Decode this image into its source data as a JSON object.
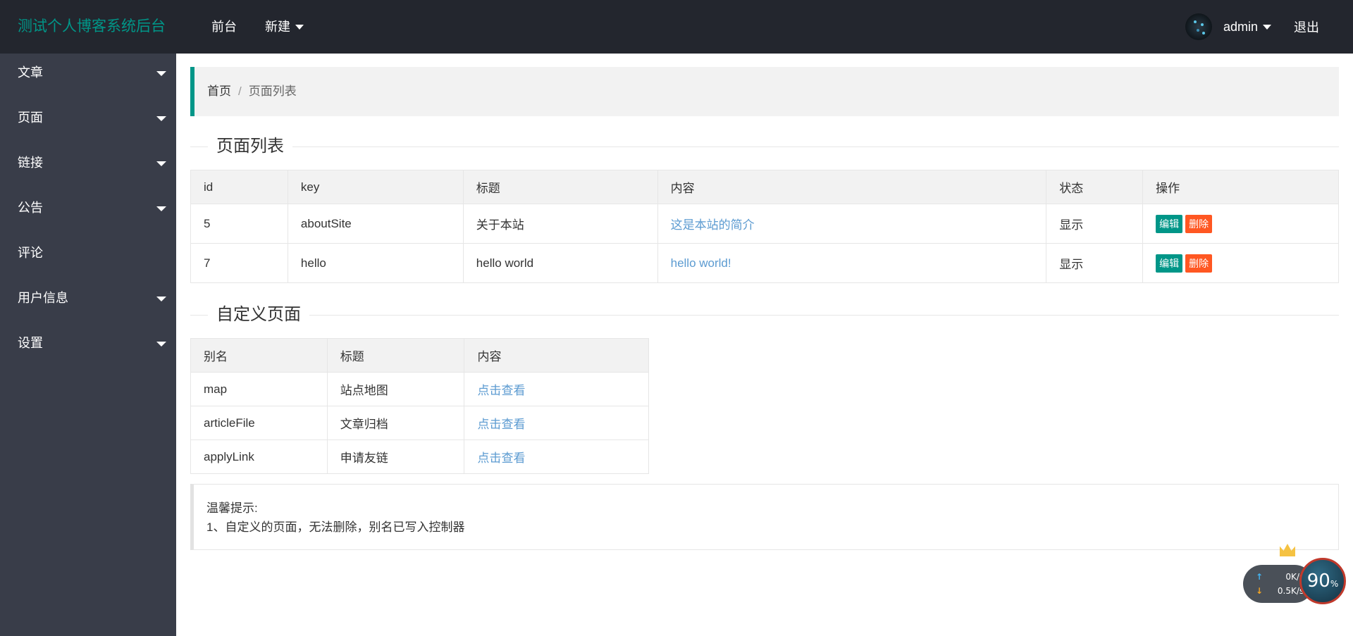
{
  "header": {
    "logo": "测试个人博客系统后台",
    "nav": [
      {
        "label": "前台",
        "dropdown": false
      },
      {
        "label": "新建",
        "dropdown": true
      }
    ],
    "user": "admin",
    "logout": "退出"
  },
  "sidebar": {
    "items": [
      {
        "label": "文章",
        "dropdown": true
      },
      {
        "label": "页面",
        "dropdown": true
      },
      {
        "label": "链接",
        "dropdown": true
      },
      {
        "label": "公告",
        "dropdown": true
      },
      {
        "label": "评论",
        "dropdown": false
      },
      {
        "label": "用户信息",
        "dropdown": true
      },
      {
        "label": "设置",
        "dropdown": true
      }
    ]
  },
  "breadcrumb": {
    "home": "首页",
    "separator": "/",
    "current": "页面列表"
  },
  "page_list": {
    "title": "页面列表",
    "headers": [
      "id",
      "key",
      "标题",
      "内容",
      "状态",
      "操作"
    ],
    "rows": [
      {
        "id": "5",
        "key": "aboutSite",
        "title": "关于本站",
        "content": "这是本站的简介",
        "status": "显示"
      },
      {
        "id": "7",
        "key": "hello",
        "title": "hello world",
        "content": "hello world!",
        "status": "显示"
      }
    ],
    "edit_label": "编辑",
    "delete_label": "删除"
  },
  "custom_pages": {
    "title": "自定义页面",
    "headers": [
      "别名",
      "标题",
      "内容"
    ],
    "rows": [
      {
        "alias": "map",
        "title": "站点地图",
        "content": "点击查看"
      },
      {
        "alias": "articleFile",
        "title": "文章归档",
        "content": "点击查看"
      },
      {
        "alias": "applyLink",
        "title": "申请友链",
        "content": "点击查看"
      }
    ]
  },
  "tips": {
    "title": "温馨提示:",
    "line1": "1、自定义的页面，无法删除，别名已写入控制器"
  },
  "speed_widget": {
    "up": "0",
    "down": "0.5",
    "unit": "K/s",
    "percent": "90",
    "percent_unit": "%"
  },
  "colors": {
    "header_bg": "#23262e",
    "sidebar_bg": "#393d49",
    "accent": "#009688",
    "danger": "#ff5722",
    "link": "#5c9bd1"
  }
}
